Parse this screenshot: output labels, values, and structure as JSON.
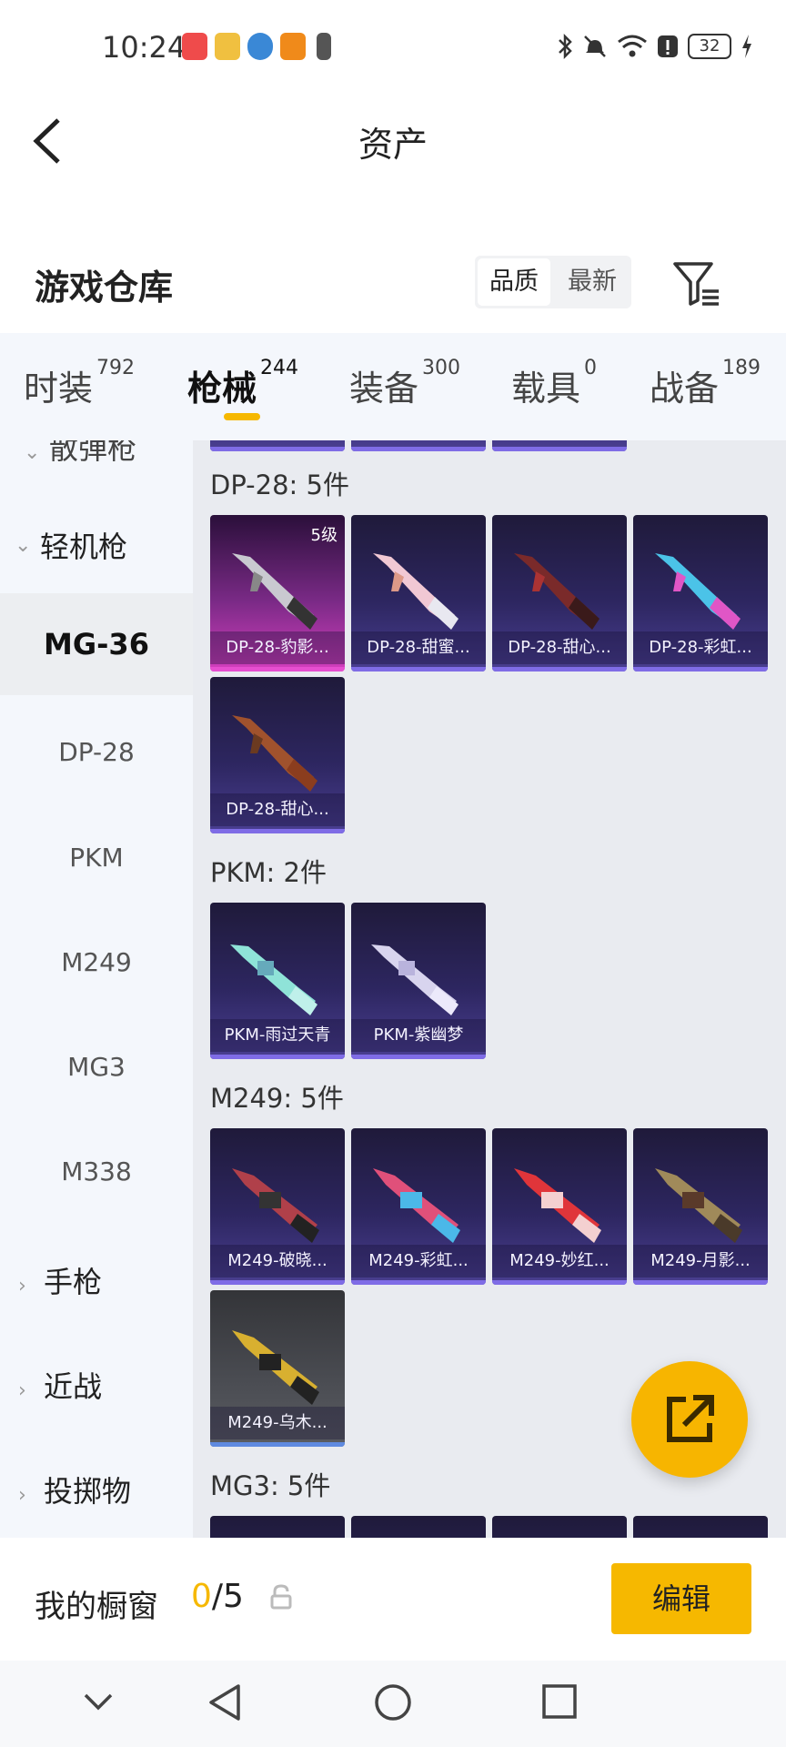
{
  "status_bar": {
    "time": "10:24",
    "battery": "32"
  },
  "header": {
    "title": "资产"
  },
  "warehouse": {
    "title": "游戏仓库",
    "sort_options": [
      "品质",
      "最新"
    ]
  },
  "tabs": [
    {
      "label": "时装",
      "count": "792"
    },
    {
      "label": "枪械",
      "count": "244",
      "active": true
    },
    {
      "label": "装备",
      "count": "300"
    },
    {
      "label": "载具",
      "count": "0"
    },
    {
      "label": "战备",
      "count": "189"
    }
  ],
  "sidebar": {
    "partial_top": "散弹枪",
    "items": [
      {
        "label": "轻机枪",
        "type": "group-expanded"
      },
      {
        "label": "MG-36",
        "type": "selected"
      },
      {
        "label": "DP-28",
        "type": "sub"
      },
      {
        "label": "PKM",
        "type": "sub"
      },
      {
        "label": "M249",
        "type": "sub"
      },
      {
        "label": "MG3",
        "type": "sub"
      },
      {
        "label": "M338",
        "type": "sub"
      },
      {
        "label": "手枪",
        "type": "group"
      },
      {
        "label": "近战",
        "type": "group"
      },
      {
        "label": "投掷物",
        "type": "group"
      }
    ]
  },
  "sections": [
    {
      "title": "DP-28: 5件",
      "items": [
        {
          "name": "DP-28-豹影...",
          "level": "5级",
          "rarity": "gold"
        },
        {
          "name": "DP-28-甜蜜...",
          "rarity": "purple"
        },
        {
          "name": "DP-28-甜心...",
          "rarity": "purple"
        },
        {
          "name": "DP-28-彩虹...",
          "rarity": "purple"
        },
        {
          "name": "DP-28-甜心...",
          "rarity": "purple"
        }
      ]
    },
    {
      "title": "PKM: 2件",
      "items": [
        {
          "name": "PKM-雨过天青",
          "rarity": "purple"
        },
        {
          "name": "PKM-紫幽梦",
          "rarity": "purple"
        }
      ]
    },
    {
      "title": "M249: 5件",
      "items": [
        {
          "name": "M249-破晓...",
          "rarity": "purple"
        },
        {
          "name": "M249-彩虹...",
          "rarity": "purple"
        },
        {
          "name": "M249-妙红...",
          "rarity": "purple"
        },
        {
          "name": "M249-月影...",
          "rarity": "purple"
        },
        {
          "name": "M249-乌木...",
          "rarity": "grey"
        }
      ]
    },
    {
      "title": "MG3: 5件",
      "items": []
    }
  ],
  "showcase": {
    "label": "我的橱窗",
    "current": "0",
    "total": "/5",
    "edit_label": "编辑"
  },
  "colors": {
    "accent": "#f6b800",
    "purple_bar": "#7f6ce6",
    "gold_bar": "#e64fd0"
  }
}
